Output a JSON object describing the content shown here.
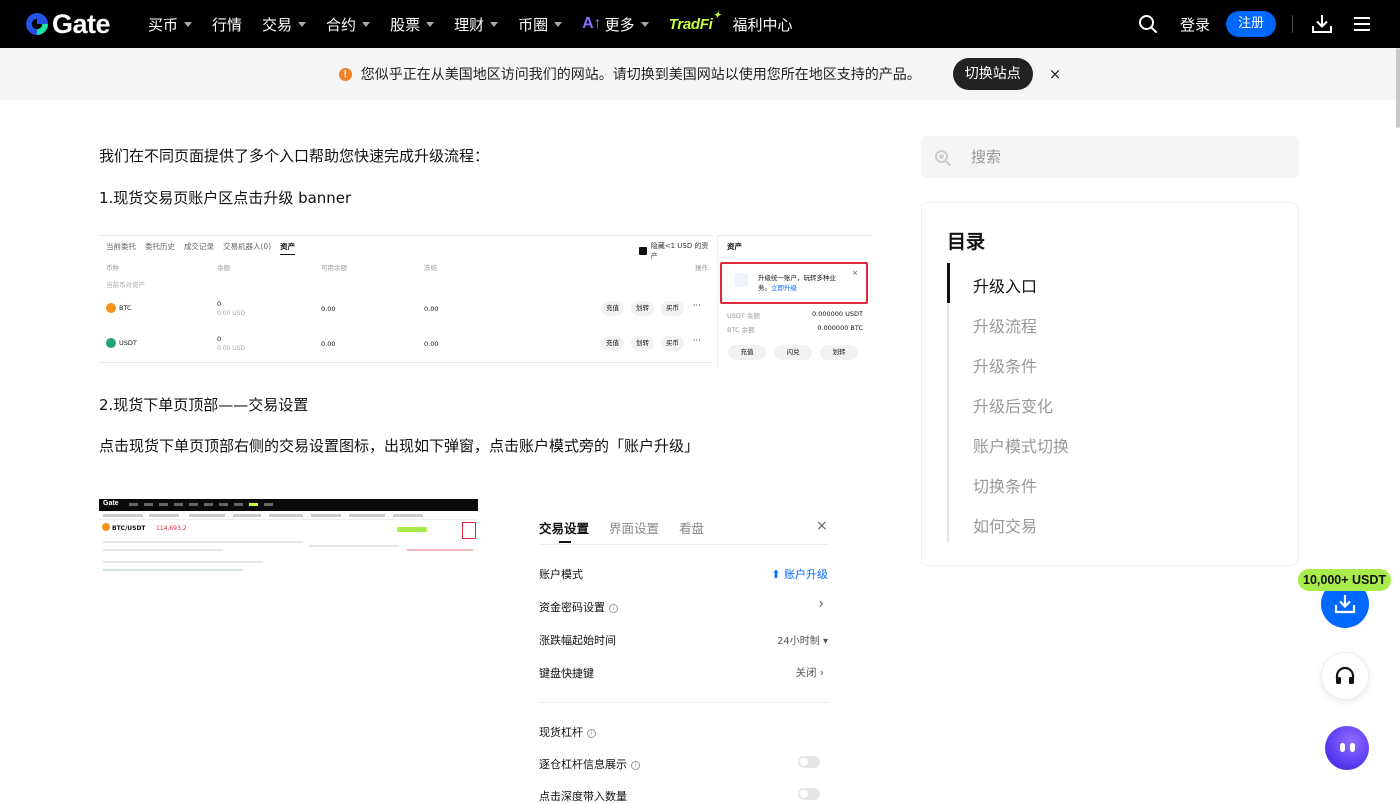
{
  "nav": {
    "logo_text": "Gate",
    "items": [
      {
        "label": "买币",
        "caret": true
      },
      {
        "label": "行情",
        "caret": false
      },
      {
        "label": "交易",
        "caret": true
      },
      {
        "label": "合约",
        "caret": true
      },
      {
        "label": "股票",
        "caret": true
      },
      {
        "label": "理财",
        "caret": true
      },
      {
        "label": "币圈",
        "caret": true
      },
      {
        "label": "更多",
        "caret": true
      }
    ],
    "ai_mark": "A↑",
    "tradfi": "TradFi",
    "welfare": "福利中心",
    "login": "登录",
    "register": "注册"
  },
  "banner": {
    "warn_glyph": "!",
    "text": "您似乎正在从美国地区访问我们的网站。请切换到美国网站以使用您所在地区支持的产品。",
    "switch_label": "切换站点",
    "close": "×"
  },
  "article": {
    "intro": "我们在不同页面提供了多个入口帮助您快速完成升级流程：",
    "step1": "1.现货交易页账户区点击升级 banner",
    "step2": "2.现货下单页顶部——交易设置",
    "step2_desc": "点击现货下单页顶部右侧的交易设置图标，出现如下弹窗，点击账户模式旁的「账户升级」"
  },
  "shot1": {
    "tabs": [
      "当前委托",
      "委托历史",
      "成交记录",
      "交易机器人(0)",
      "资产"
    ],
    "hide_small": "隐藏<1 USD 的资产",
    "headers": {
      "coin": "币种",
      "balance": "余额",
      "available": "可用余额",
      "frozen": "冻结",
      "action": "操作"
    },
    "sub": "当前币对资产",
    "rows": [
      {
        "coin": "BTC",
        "balance": "0",
        "balance_usd": "0.00 USD",
        "available": "0.00",
        "frozen": "0.00",
        "color": "#f7931a"
      },
      {
        "coin": "USDT",
        "balance": "0",
        "balance_usd": "0.00 USD",
        "available": "0.00",
        "frozen": "0.00",
        "color": "#26a17b"
      }
    ],
    "row_buttons": [
      "充值",
      "划转",
      "买币"
    ],
    "more": "···",
    "asset_title": "资产",
    "promo_line1": "升级统一账户，玩转多种业",
    "promo_line2": "务。",
    "promo_link": "立即升级",
    "promo_close": "×",
    "usdt_label": "USDT 余额",
    "usdt_value": "0.000000 USDT",
    "btc_label": "BTC 余额",
    "btc_value": "0.000000 BTC",
    "right_buttons": [
      "充值",
      "闪兑",
      "划转"
    ]
  },
  "shot2": {
    "logo": "Gate",
    "pair": "BTC/USDT",
    "price": "114,693.2"
  },
  "settings": {
    "tabs": [
      "交易设置",
      "界面设置",
      "看盘"
    ],
    "close": "×",
    "rows": [
      {
        "label": "账户模式",
        "value": "⬆ 账户升级",
        "blue": true
      },
      {
        "label": "资金密码设置",
        "value": "›",
        "info": true
      },
      {
        "label": "涨跌幅起始时间",
        "value": "24小时制 ▾"
      },
      {
        "label": "键盘快捷键",
        "value": "关闭 ›"
      }
    ],
    "leverage": "现货杠杆",
    "isolated": "逐仓杠杆信息展示",
    "depth": "点击深度带入数量",
    "info_glyph": "i"
  },
  "sidebar": {
    "search_placeholder": "搜索",
    "toc_title": "目录",
    "toc_items": [
      "升级入口",
      "升级流程",
      "升级条件",
      "升级后变化",
      "账户模式切换",
      "切换条件",
      "如何交易"
    ],
    "active_index": 0
  },
  "floating": {
    "promo": "10,000+ USDT"
  },
  "colors": {
    "brand_blue": "#0068ff",
    "accent_green": "#a7ec4a",
    "nav_bg": "#000000",
    "warn_orange": "#f0802a",
    "highlight_red": "#e0283c"
  }
}
